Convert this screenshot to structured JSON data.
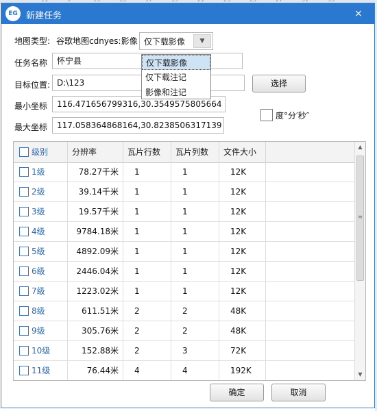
{
  "window": {
    "logo": "EG",
    "title": "新建任务",
    "close": "×"
  },
  "top_strip_ticks": [
    "11",
    "5",
    "13",
    "15",
    "17",
    "19",
    "21",
    "23",
    "25",
    "27",
    "31",
    "33"
  ],
  "form": {
    "map_type_label": "地图类型:",
    "map_type_value": "谷歌地图cdnyes:影像",
    "download_select_value": "仅下载影像",
    "download_options": [
      "仅下载影像",
      "仅下载注记",
      "影像和注记"
    ],
    "task_name_label": "任务名称",
    "task_name_value": "怀宁县",
    "target_label": "目标位置:",
    "target_value": "D:\\123",
    "choose_button": "选择",
    "min_coord_label": "最小坐标",
    "min_coord_value": "116.471656799316,30.3549575805664",
    "max_coord_label": "最大坐标",
    "max_coord_value": "117.058364868164,30.8238506317139",
    "dms_label": "度°分′秒″"
  },
  "table": {
    "headers": [
      "级别",
      "分辨率",
      "瓦片行数",
      "瓦片列数",
      "文件大小"
    ],
    "rows": [
      {
        "level": "1级",
        "res": "78.27千米",
        "rows": "1",
        "cols": "1",
        "size": "12K"
      },
      {
        "level": "2级",
        "res": "39.14千米",
        "rows": "1",
        "cols": "1",
        "size": "12K"
      },
      {
        "level": "3级",
        "res": "19.57千米",
        "rows": "1",
        "cols": "1",
        "size": "12K"
      },
      {
        "level": "4级",
        "res": "9784.18米",
        "rows": "1",
        "cols": "1",
        "size": "12K"
      },
      {
        "level": "5级",
        "res": "4892.09米",
        "rows": "1",
        "cols": "1",
        "size": "12K"
      },
      {
        "level": "6级",
        "res": "2446.04米",
        "rows": "1",
        "cols": "1",
        "size": "12K"
      },
      {
        "level": "7级",
        "res": "1223.02米",
        "rows": "1",
        "cols": "1",
        "size": "12K"
      },
      {
        "level": "8级",
        "res": "611.51米",
        "rows": "2",
        "cols": "2",
        "size": "48K"
      },
      {
        "level": "9级",
        "res": "305.76米",
        "rows": "2",
        "cols": "2",
        "size": "48K"
      },
      {
        "level": "10级",
        "res": "152.88米",
        "rows": "2",
        "cols": "3",
        "size": "72K"
      },
      {
        "level": "11级",
        "res": "76.44米",
        "rows": "4",
        "cols": "4",
        "size": "192K"
      }
    ]
  },
  "buttons": {
    "ok": "确定",
    "cancel": "取消"
  },
  "colors": {
    "titlebar": "#2b78d0",
    "selected_option": "#cfe3f7",
    "level_text": "#2a6ab8"
  }
}
